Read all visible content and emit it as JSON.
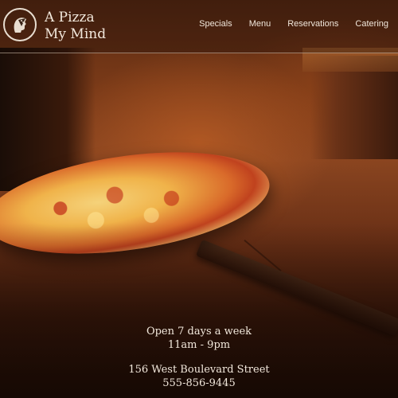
{
  "brand": {
    "line1": "A Pizza",
    "line2": "My Mind",
    "logo_icon": "pizza-slice-head-icon"
  },
  "nav": {
    "items": [
      {
        "label": "Specials"
      },
      {
        "label": "Menu"
      },
      {
        "label": "Reservations"
      },
      {
        "label": "Catering"
      }
    ]
  },
  "info": {
    "hours_line1": "Open 7 days a week",
    "hours_line2": "11am - 9pm",
    "address": "156 West Boulevard Street",
    "phone": "555-856-9445"
  },
  "colors": {
    "header_text": "#f2e8dc",
    "header_divider": "#dcc8b4",
    "oven_glow": "#d96a2a"
  }
}
